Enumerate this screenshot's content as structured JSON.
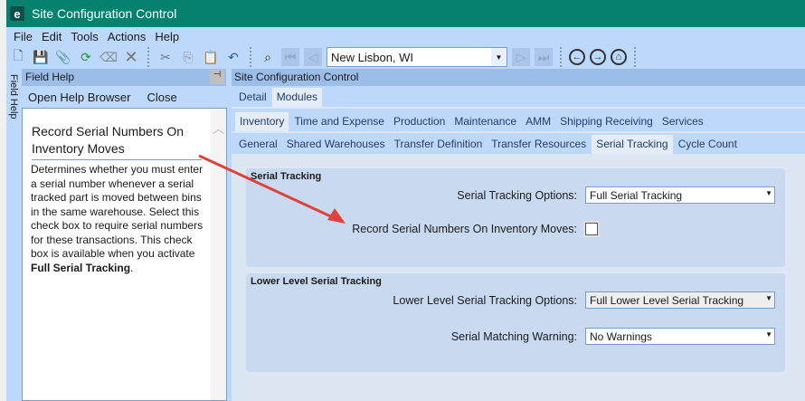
{
  "window": {
    "title": "Site Configuration Control"
  },
  "menu": [
    "File",
    "Edit",
    "Tools",
    "Actions",
    "Help"
  ],
  "toolbar": {
    "site": "New Lisbon, WI"
  },
  "field_help": {
    "vertical_tab": "Field Help",
    "header": "Field Help",
    "open_browser": "Open Help Browser",
    "close": "Close",
    "title": "Record Serial Numbers On Inventory Moves",
    "text": "Determines whether you must enter a serial number whenever a serial tracked part is moved between bins in the same warehouse. Select this check box to require serial numbers for these transactions. This check box is available when you activate ",
    "text_bold": "Full Serial Tracking",
    "text_end": "."
  },
  "panel": {
    "header": "Site Configuration Control",
    "tabs1": [
      "Detail",
      "Modules"
    ],
    "tabs2": [
      "Inventory",
      "Time and Expense",
      "Production",
      "Maintenance",
      "AMM",
      "Shipping Receiving",
      "Services"
    ],
    "tabs3": [
      "General",
      "Shared Warehouses",
      "Transfer Definition",
      "Transfer Resources",
      "Serial Tracking",
      "Cycle Count"
    ],
    "group1": {
      "title": "Serial Tracking",
      "options_label": "Serial Tracking Options:",
      "options_value": "Full Serial Tracking",
      "record_label": "Record Serial Numbers On Inventory Moves:",
      "record_checked": false
    },
    "group2": {
      "title": "Lower Level Serial Tracking",
      "options_label": "Lower Level Serial Tracking Options:",
      "options_value": "Full Lower Level Serial Tracking",
      "warning_label": "Serial Matching Warning:",
      "warning_value": "No Warnings"
    }
  },
  "colors": {
    "titlebar": "#05826f",
    "chrome": "#bcd9fc",
    "arrow": "#e0413a"
  }
}
